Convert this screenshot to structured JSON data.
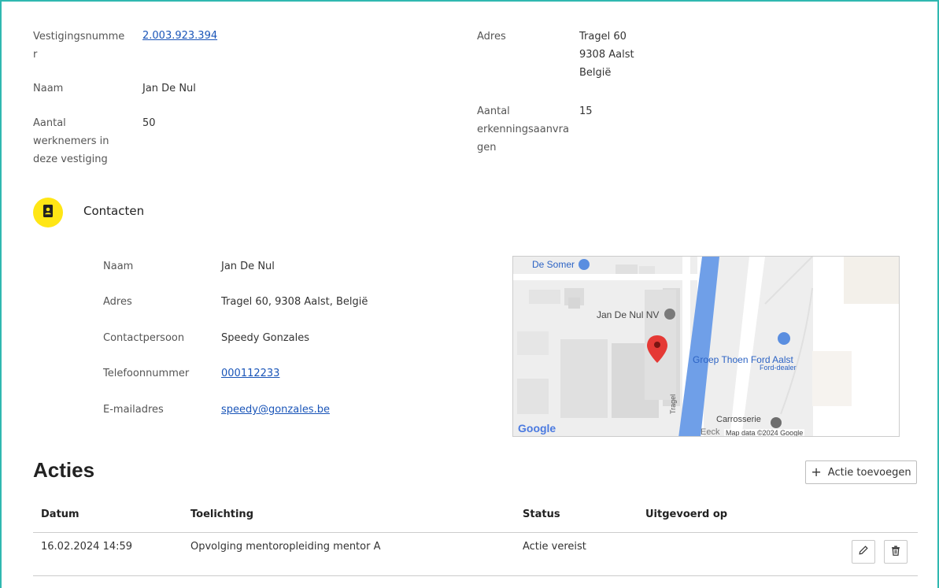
{
  "vestiging": {
    "nummer_label_line1": "Vestigingsnumme",
    "nummer_label_line2": "r",
    "nummer_value": "2.003.923.394",
    "naam_label": "Naam",
    "naam_value": "Jan De Nul",
    "werknemers_label_line1": "Aantal",
    "werknemers_label_line2": "werknemers in",
    "werknemers_label_line3": "deze vestiging",
    "werknemers_value": "50",
    "adres_label": "Adres",
    "adres_line1": "Tragel 60",
    "adres_line2": "9308 Aalst",
    "adres_line3": "België",
    "erkenning_label_line1": "Aantal",
    "erkenning_label_line2": "erkenningsaanvra",
    "erkenning_label_line3": "gen",
    "erkenning_value": "15"
  },
  "contacten": {
    "title": "Contacten",
    "icon": "contact-book-icon",
    "rows": [
      {
        "label": "Naam",
        "value": "Jan De Nul"
      },
      {
        "label": "Adres",
        "value": "Tragel 60, 9308 Aalst, België"
      },
      {
        "label": "Contactpersoon",
        "value": "Speedy Gonzales"
      },
      {
        "label": "Telefoonnummer",
        "value": "000112233"
      },
      {
        "label": "E-mailadres",
        "value": "speedy@gonzales.be"
      }
    ]
  },
  "map": {
    "place_de_somer": "De Somer",
    "place_jan_de_nul": "Jan De Nul NV",
    "place_groep_thoen": "Groep Thoen Ford Aalst",
    "place_ford_dealer": "Ford-dealer",
    "place_carrosserie": "Carrosserie",
    "place_eeck": "Eeck",
    "street_tragel": "Tragel",
    "google_logo": "Google",
    "attribution": "Map data ©2024 Google"
  },
  "acties": {
    "title": "Acties",
    "add_button": "Actie toevoegen",
    "columns": [
      "Datum",
      "Toelichting",
      "Status",
      "Uitgevoerd op"
    ],
    "rows": [
      {
        "datum": "16.02.2024 14:59",
        "toelichting": "Opvolging mentoropleiding mentor A",
        "status": "Actie vereist",
        "uitgevoerd_op": ""
      }
    ]
  },
  "colors": {
    "accent_border": "#2fb8b0",
    "badge_yellow": "#ffe615",
    "link_blue": "#1a55b8",
    "map_river": "#6f9fe8",
    "map_pin": "#e53935"
  }
}
